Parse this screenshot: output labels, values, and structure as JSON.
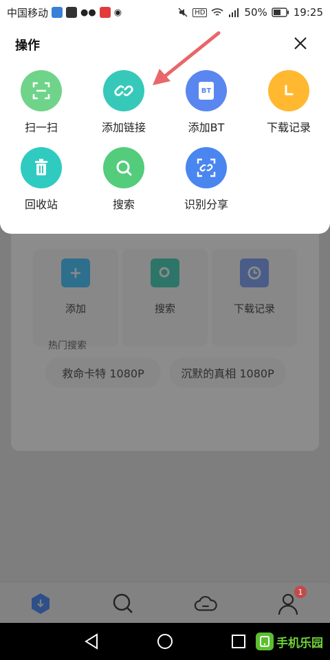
{
  "status_bar": {
    "carrier": "中国移动",
    "battery": "50%",
    "time": "19:25",
    "hd": "HD"
  },
  "sheet": {
    "title": "操作",
    "actions": [
      {
        "label": "扫一扫",
        "icon": "scan-icon",
        "color": "#6fd48a"
      },
      {
        "label": "添加链接",
        "icon": "link-icon",
        "color": "#36c9b9"
      },
      {
        "label": "添加BT",
        "icon": "bt-icon",
        "color": "#5a86f0",
        "icon_text": "BT"
      },
      {
        "label": "下载记录",
        "icon": "clock-icon",
        "color": "#ffb830"
      },
      {
        "label": "回收站",
        "icon": "trash-icon",
        "color": "#2fcbc0"
      },
      {
        "label": "搜索",
        "icon": "search-icon",
        "color": "#53cc7c"
      },
      {
        "label": "识别分享",
        "icon": "share-recognize-icon",
        "color": "#4a86f0"
      }
    ]
  },
  "background": {
    "quick_actions": [
      {
        "label": "添加",
        "icon": "plus-icon",
        "color": "#2e6f8e"
      },
      {
        "label": "搜索",
        "icon": "search-icon",
        "color": "#2d7568"
      },
      {
        "label": "下载记录",
        "icon": "clock-icon",
        "color": "#4a5c88"
      }
    ],
    "hot_search_title": "热门搜索",
    "hot_searches": [
      "救命卡特 1080P",
      "沉默的真相 1080P"
    ]
  },
  "tab_bar": {
    "tabs": [
      "download-tab-icon",
      "search-tab-icon",
      "cloud-tab-icon",
      "profile-tab-icon"
    ],
    "badge": "1"
  },
  "watermark": {
    "text": "手机乐园"
  },
  "colors": {
    "accent_arrow": "#e8676b"
  }
}
